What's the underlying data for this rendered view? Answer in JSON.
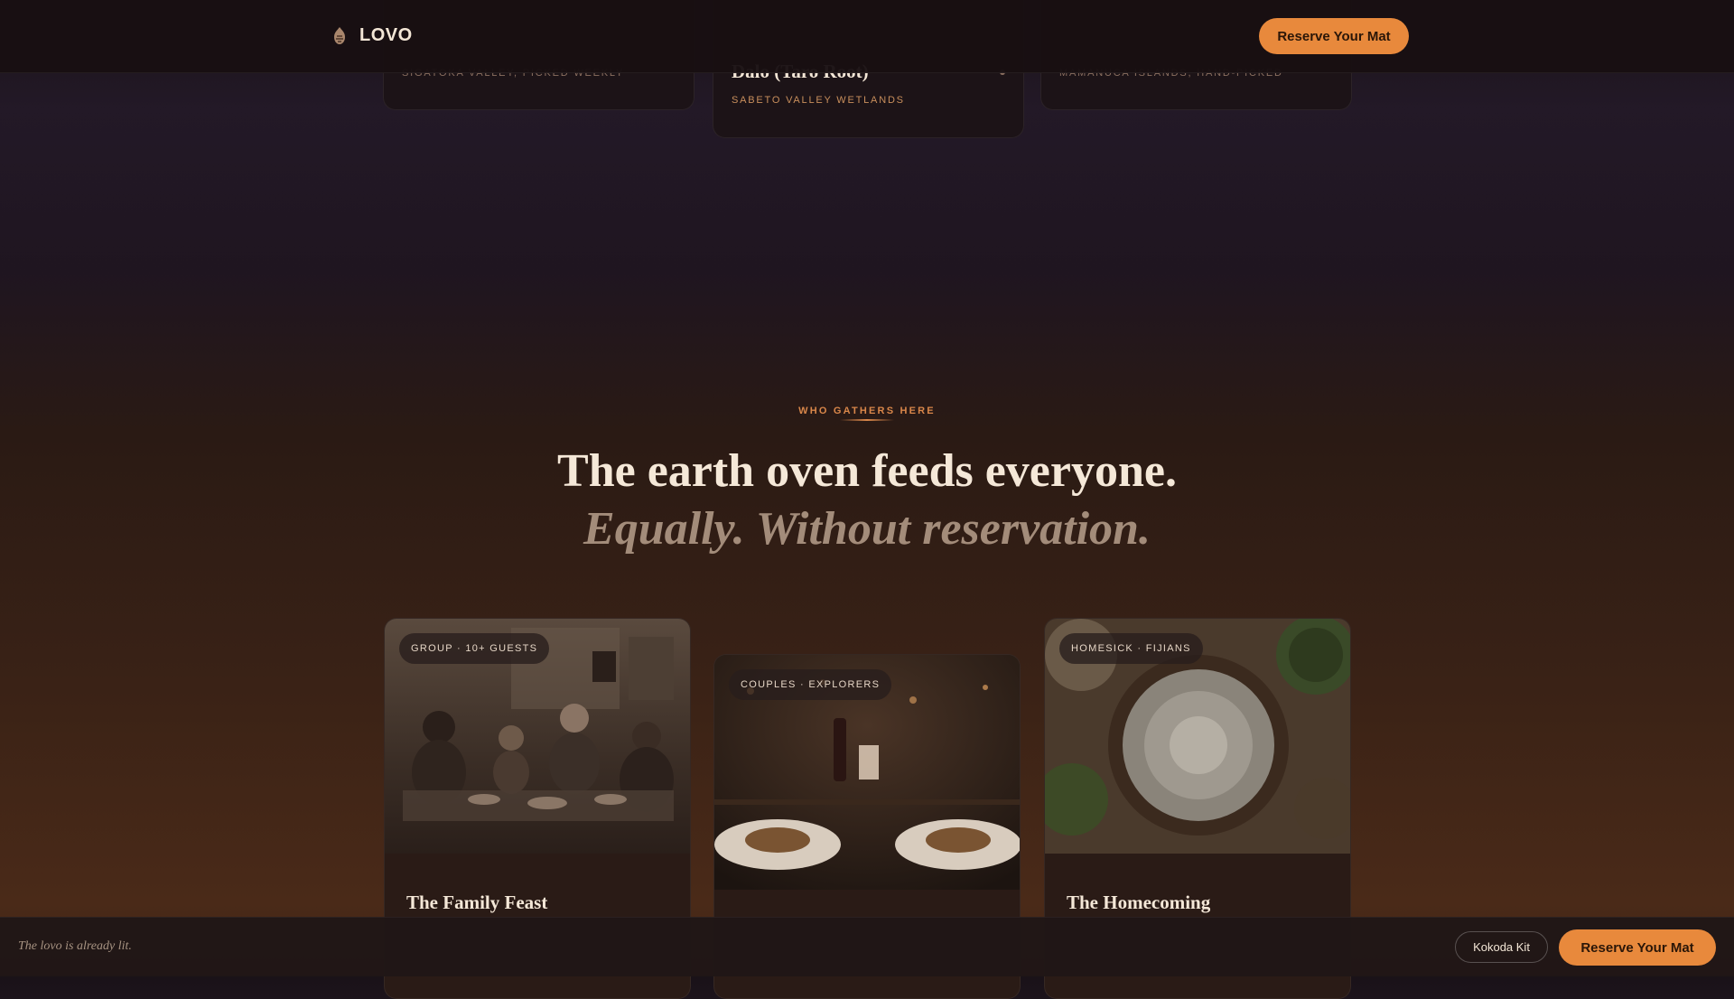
{
  "header": {
    "brand_name": "LOVO",
    "brand_icon": "lovo-flame-icon",
    "cta_label": "Reserve Your Mat"
  },
  "top_cards": [
    {
      "location": "SIGATOKA VALLEY, PICKED WEEKLY"
    },
    {
      "title": "Dalo (Taro Root)",
      "location": "SABETO VALLEY WETLANDS"
    },
    {
      "location": "MAMANUCA ISLANDS, HAND-PICKED"
    }
  ],
  "section": {
    "eyebrow": "WHO GATHERS HERE",
    "headline": "The earth oven feeds everyone.",
    "subline": "Equally. Without reservation."
  },
  "cards": [
    {
      "tag": "GROUP · 10+ GUESTS",
      "title": "The Family Feast"
    },
    {
      "tag": "COUPLES · EXPLORERS",
      "title": ""
    },
    {
      "tag": "HOMESICK · FIJIANS",
      "title": "The Homecoming"
    }
  ],
  "footer": {
    "tagline": "The lovo is already lit.",
    "secondary_label": "Kokoda Kit",
    "cta_label": "Reserve Your Mat"
  },
  "colors": {
    "accent": "#e8893c",
    "background": "#231927",
    "text": "#f3e6d6"
  }
}
